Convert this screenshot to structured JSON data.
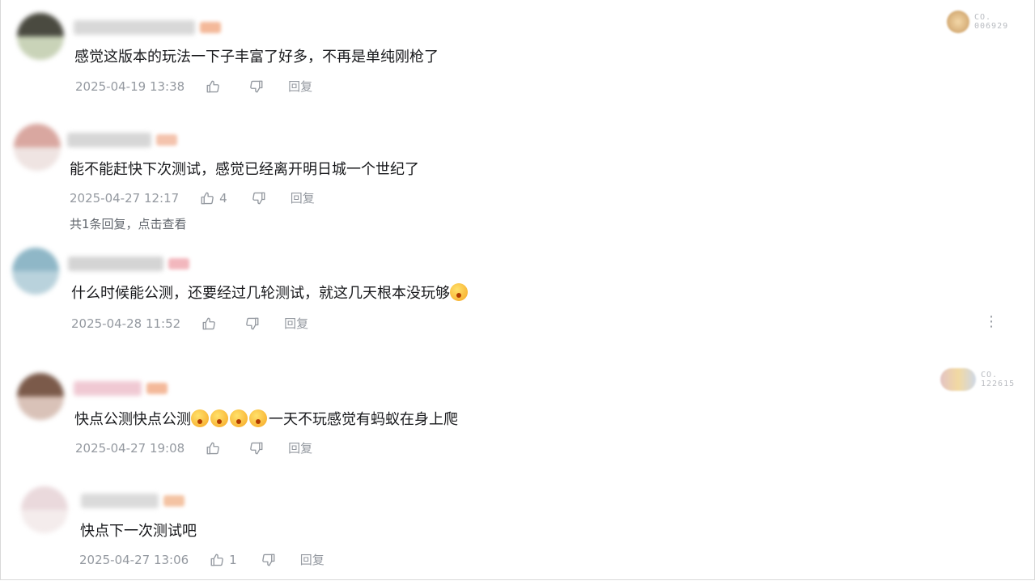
{
  "comments": [
    {
      "text": "感觉这版本的玩法一下子丰富了好多，不再是单纯刚枪了",
      "time": "2025-04-19 13:38",
      "likes": "",
      "reply_label": "回复",
      "fan_badge": {
        "line1": "CO.",
        "line2": "006929"
      },
      "avatar_colors": [
        "#4a4a40",
        "#c9d3b8"
      ]
    },
    {
      "text": "能不能赶快下次测试，感觉已经离开明日城一个世纪了",
      "time": "2025-04-27 12:17",
      "likes": "4",
      "reply_label": "回复",
      "sub_replies": "共1条回复，点击查看",
      "avatar_colors": [
        "#d9a7a0",
        "#efe4e2"
      ]
    },
    {
      "text": "什么时候能公测，还要经过几轮测试，就这几天根本没玩够",
      "time": "2025-04-28 11:52",
      "likes": "",
      "reply_label": "回复",
      "more_label": "⋮",
      "avatar_colors": [
        "#8fb7c7",
        "#b9d2dc"
      ]
    },
    {
      "text_before": "快点公测快点公测",
      "emoji_count": 4,
      "text_after": "一天不玩感觉有蚂蚁在身上爬",
      "time": "2025-04-27 19:08",
      "likes": "",
      "reply_label": "回复",
      "fan_badge": {
        "line1": "CO.",
        "line2": "122615"
      },
      "avatar_colors": [
        "#7b5a4a",
        "#d9c2b8"
      ]
    },
    {
      "text": "快点下一次测试吧",
      "time": "2025-04-27 13:06",
      "likes": "1",
      "reply_label": "回复",
      "avatar_colors": [
        "#ead9dc",
        "#f4ecec"
      ]
    }
  ],
  "colors": {
    "text": "#18191c",
    "meta": "#9499a0",
    "name_tag": "#f4b99a"
  },
  "icons": [
    "thumbs-up-icon",
    "thumbs-down-icon",
    "more-vertical-icon"
  ]
}
